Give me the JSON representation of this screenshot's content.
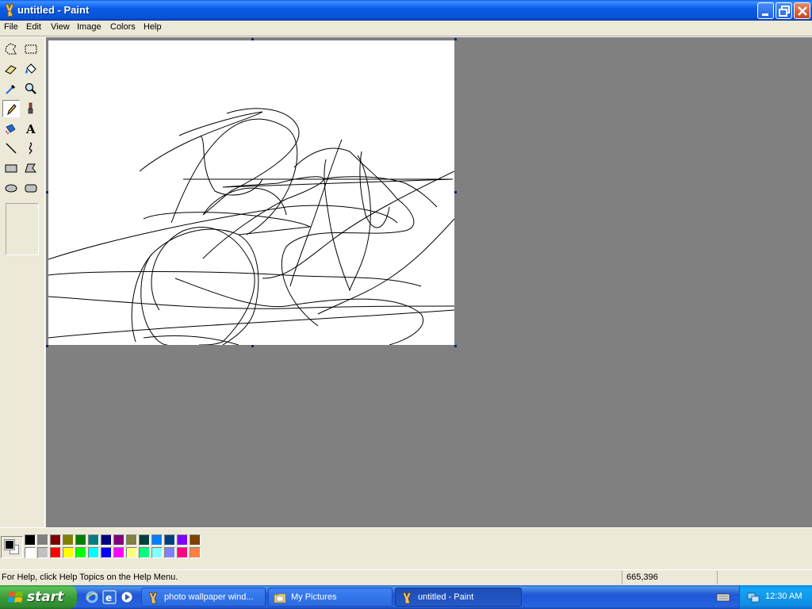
{
  "window": {
    "title": "untitled - Paint"
  },
  "menu": [
    "File",
    "Edit",
    "View",
    "Image",
    "Colors",
    "Help"
  ],
  "tools": [
    "free-form-select-icon",
    "rect-select-icon",
    "eraser-icon",
    "fill-icon",
    "color-picker-icon",
    "magnifier-icon",
    "pencil-icon",
    "brush-icon",
    "airbrush-icon",
    "text-icon",
    "line-icon",
    "curve-icon",
    "rectangle-icon",
    "polygon-icon",
    "ellipse-icon",
    "rounded-rect-icon"
  ],
  "selected_tool": "pencil-icon",
  "colors": {
    "foreground": "#000000",
    "background": "#FFFFFF",
    "palette_top": [
      "#000000",
      "#808080",
      "#800000",
      "#808000",
      "#008000",
      "#008080",
      "#000080",
      "#800080",
      "#808040",
      "#004040",
      "#0080FF",
      "#004080",
      "#8000FF",
      "#804000"
    ],
    "palette_bottom": [
      "#FFFFFF",
      "#C0C0C0",
      "#FF0000",
      "#FFFF00",
      "#00FF00",
      "#00FFFF",
      "#0000FF",
      "#FF00FF",
      "#FFFF80",
      "#00FF80",
      "#80FFFF",
      "#8080FF",
      "#FF0080",
      "#FF8040"
    ]
  },
  "status": {
    "help_text": "For Help, click Help Topics on the Help Menu.",
    "coords": "665,396"
  },
  "taskbar": {
    "start_label": "start",
    "tasks": [
      {
        "label": "photo wallpaper wind...",
        "icon": "paint-icon"
      },
      {
        "label": "My Pictures",
        "icon": "folder-icon"
      },
      {
        "label": "untitled - Paint",
        "icon": "paint-icon",
        "active": true
      }
    ],
    "clock": "12:30 AM"
  }
}
